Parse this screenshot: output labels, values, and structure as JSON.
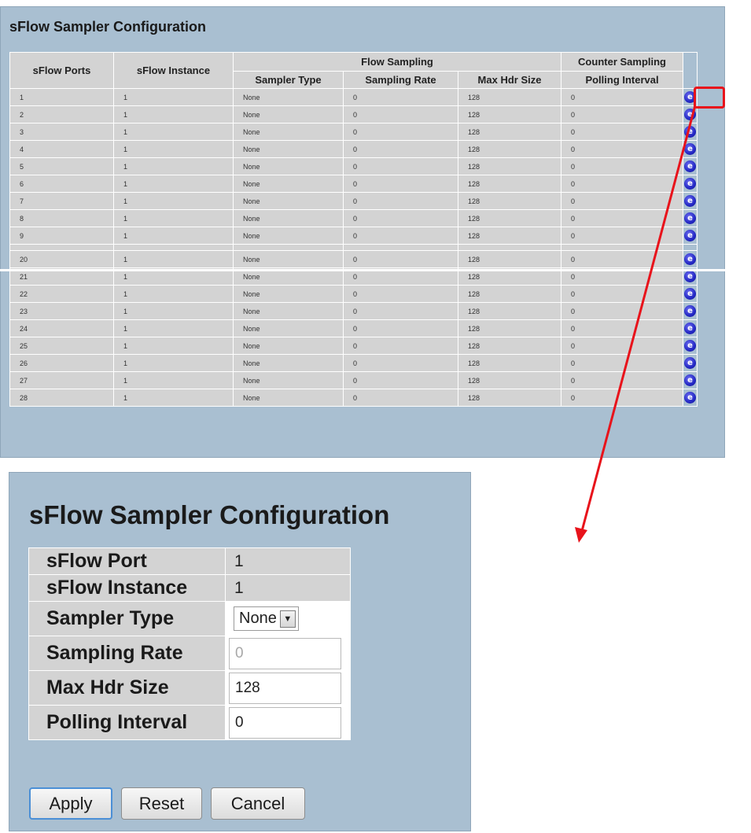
{
  "list": {
    "title": "sFlow Sampler Configuration",
    "headers": {
      "ports": "sFlow Ports",
      "instance": "sFlow Instance",
      "flow_sampling": "Flow Sampling",
      "counter_sampling": "Counter Sampling",
      "sampler_type": "Sampler Type",
      "sampling_rate": "Sampling Rate",
      "max_hdr_size": "Max Hdr Size",
      "polling_interval": "Polling Interval"
    },
    "rows_top": [
      {
        "port": "1",
        "instance": "1",
        "type": "None",
        "rate": "0",
        "hdr": "128",
        "poll": "0"
      },
      {
        "port": "2",
        "instance": "1",
        "type": "None",
        "rate": "0",
        "hdr": "128",
        "poll": "0"
      },
      {
        "port": "3",
        "instance": "1",
        "type": "None",
        "rate": "0",
        "hdr": "128",
        "poll": "0"
      },
      {
        "port": "4",
        "instance": "1",
        "type": "None",
        "rate": "0",
        "hdr": "128",
        "poll": "0"
      },
      {
        "port": "5",
        "instance": "1",
        "type": "None",
        "rate": "0",
        "hdr": "128",
        "poll": "0"
      },
      {
        "port": "6",
        "instance": "1",
        "type": "None",
        "rate": "0",
        "hdr": "128",
        "poll": "0"
      },
      {
        "port": "7",
        "instance": "1",
        "type": "None",
        "rate": "0",
        "hdr": "128",
        "poll": "0"
      },
      {
        "port": "8",
        "instance": "1",
        "type": "None",
        "rate": "0",
        "hdr": "128",
        "poll": "0"
      },
      {
        "port": "9",
        "instance": "1",
        "type": "None",
        "rate": "0",
        "hdr": "128",
        "poll": "0"
      }
    ],
    "rows_bottom": [
      {
        "port": "20",
        "instance": "1",
        "type": "None",
        "rate": "0",
        "hdr": "128",
        "poll": "0"
      },
      {
        "port": "21",
        "instance": "1",
        "type": "None",
        "rate": "0",
        "hdr": "128",
        "poll": "0"
      },
      {
        "port": "22",
        "instance": "1",
        "type": "None",
        "rate": "0",
        "hdr": "128",
        "poll": "0"
      },
      {
        "port": "23",
        "instance": "1",
        "type": "None",
        "rate": "0",
        "hdr": "128",
        "poll": "0"
      },
      {
        "port": "24",
        "instance": "1",
        "type": "None",
        "rate": "0",
        "hdr": "128",
        "poll": "0"
      },
      {
        "port": "25",
        "instance": "1",
        "type": "None",
        "rate": "0",
        "hdr": "128",
        "poll": "0"
      },
      {
        "port": "26",
        "instance": "1",
        "type": "None",
        "rate": "0",
        "hdr": "128",
        "poll": "0"
      },
      {
        "port": "27",
        "instance": "1",
        "type": "None",
        "rate": "0",
        "hdr": "128",
        "poll": "0"
      },
      {
        "port": "28",
        "instance": "1",
        "type": "None",
        "rate": "0",
        "hdr": "128",
        "poll": "0"
      }
    ],
    "edit_icon": "edit-icon",
    "edit_glyph": "e"
  },
  "detail": {
    "title": "sFlow Sampler Configuration",
    "port_label": "sFlow Port",
    "port_value": "1",
    "instance_label": "sFlow Instance",
    "instance_value": "1",
    "sampler_type_label": "Sampler Type",
    "sampler_type_value": "None",
    "sampling_rate_label": "Sampling Rate",
    "sampling_rate_value": "0",
    "max_hdr_label": "Max Hdr Size",
    "max_hdr_value": "128",
    "polling_label": "Polling Interval",
    "polling_value": "0",
    "select_arrow_glyph": "▼",
    "apply_label": "Apply",
    "reset_label": "Reset",
    "cancel_label": "Cancel"
  },
  "colors": {
    "panel_bg": "#a9bfd1",
    "cell_bg": "#d3d3d3",
    "highlight": "#e8131b",
    "icon_blue": "#2327c4"
  }
}
